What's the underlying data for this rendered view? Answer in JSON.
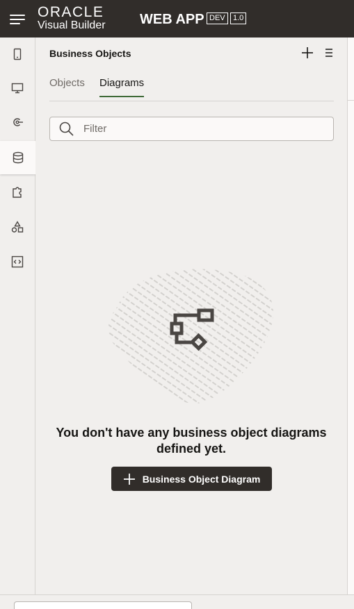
{
  "header": {
    "logo_brand": "ORACLE",
    "logo_product": "Visual Builder",
    "app_title": "WEB APP",
    "env_badge": "DEV",
    "version_badge": "1.0",
    "background_color": "#312d2a"
  },
  "rail": {
    "items": [
      {
        "name": "mobile-apps",
        "icon": "phone-icon"
      },
      {
        "name": "web-apps",
        "icon": "monitor-icon"
      },
      {
        "name": "services",
        "icon": "service-connection-icon"
      },
      {
        "name": "business-objects",
        "icon": "database-icon",
        "active": true
      },
      {
        "name": "components",
        "icon": "puzzle-icon"
      },
      {
        "name": "processes",
        "icon": "shapes-icon"
      },
      {
        "name": "source",
        "icon": "code-icon"
      }
    ]
  },
  "panel": {
    "title": "Business Objects",
    "tabs": [
      {
        "label": "Objects",
        "selected": false
      },
      {
        "label": "Diagrams",
        "selected": true
      }
    ],
    "filter": {
      "placeholder": "Filter",
      "value": ""
    },
    "empty_state": {
      "message": "You don't have any business object diagrams defined yet.",
      "button_label": "Business Object Diagram",
      "illustration_icon": "diagram-icon"
    }
  },
  "colors": {
    "accent_tab_underline": "#3f6a38",
    "button_background": "#312d2a",
    "page_background": "#f1efed"
  }
}
